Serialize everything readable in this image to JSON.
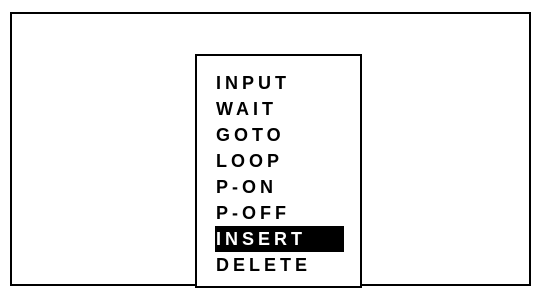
{
  "menu": {
    "selected_index": 6,
    "items": [
      {
        "label": "INPUT"
      },
      {
        "label": "WAIT"
      },
      {
        "label": "GOTO"
      },
      {
        "label": "LOOP"
      },
      {
        "label": "P-ON"
      },
      {
        "label": "P-OFF"
      },
      {
        "label": "INSERT"
      },
      {
        "label": "DELETE"
      }
    ]
  },
  "colors": {
    "background": "#ffffff",
    "foreground": "#000000",
    "highlight_bg": "#000000",
    "highlight_fg": "#ffffff"
  }
}
